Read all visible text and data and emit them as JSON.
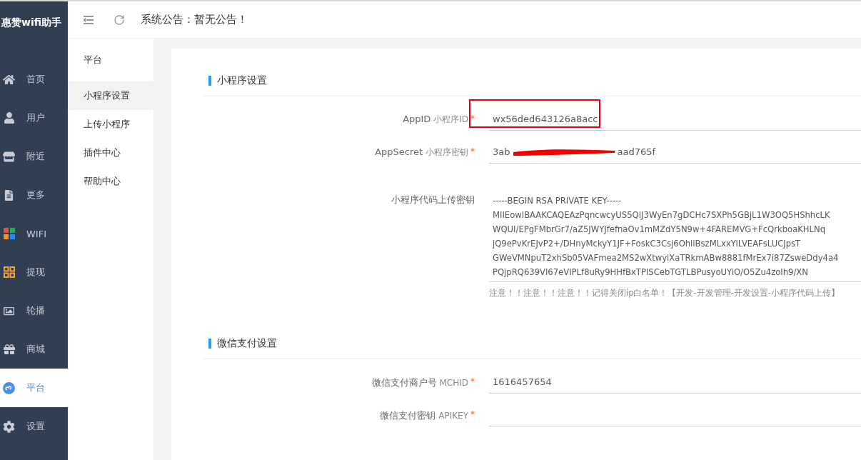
{
  "sidebar": {
    "title": "惠赞wifi助手",
    "items": [
      {
        "label": "首页",
        "selected": false
      },
      {
        "label": "用户",
        "selected": false
      },
      {
        "label": "附近",
        "selected": false
      },
      {
        "label": "更多",
        "selected": false
      },
      {
        "label": "WIFI",
        "selected": false
      },
      {
        "label": "提现",
        "selected": false
      },
      {
        "label": "轮播",
        "selected": false
      },
      {
        "label": "商城",
        "selected": false
      },
      {
        "label": "平台",
        "selected": true
      },
      {
        "label": "设置",
        "selected": false
      }
    ]
  },
  "topbar": {
    "notice": "系统公告：暂无公告！"
  },
  "submenu": {
    "title": "平台",
    "items": [
      {
        "label": "小程序设置",
        "selected": true
      },
      {
        "label": "上传小程序",
        "selected": false
      },
      {
        "label": "插件中心",
        "selected": false
      },
      {
        "label": "帮助中心",
        "selected": false
      }
    ]
  },
  "sections": [
    {
      "title": "小程序设置",
      "fields": [
        {
          "kind": "input",
          "label": "AppID",
          "sublabel": "小程序ID",
          "required_mark": "*",
          "value": "wx56ded643126a8acc",
          "highlighted": true
        },
        {
          "kind": "redacted",
          "label": "AppSecret",
          "sublabel": "小程序密钥",
          "required_mark": "*",
          "value_start": "3ab",
          "value_end": "aad765f"
        },
        {
          "kind": "textarea",
          "label": "小程序代码上传密钥",
          "lines": [
            "-----BEGIN RSA PRIVATE KEY-----",
            "MIIEowIBAAKCAQEAzPqncwcyUS5QIJ3WyEn7gDCHc7SXPh5GBjL1W3OQ5HShhcLK",
            "WQUI/EPgFMbrGr7/aZ5JWYJfefnaOv1mMZdY5N9w+4FAREMVG+FcQrkboaKHLNq",
            "jQ9ePvKrEJvP2+/DHnyMckyY1JF+FoskC3Csj6OhliBszMLxxYiLVEAFsLUCJpsT",
            "GWeVMNpuT2xhSb05VAFmea2MS2wXtwyiXaTRkmABw8881fMrEx7i87ZsweDdy4a4",
            "PQjpRQ639VI67eVIPLf8uRy9HHfBxTPISCebTGTLBPusyoUYiO/O5Zu4zoIh9/XN"
          ],
          "hint": "注意！！注意！！注意！！记得关闭ip白名单！【开发-开发管理-开发设置-小程序代码上传】"
        }
      ]
    },
    {
      "title": "微信支付设置",
      "fields": [
        {
          "kind": "input",
          "label": "微信支付商户号",
          "sublabel": "MCHID",
          "required_mark": "*",
          "value": "1616457654"
        },
        {
          "kind": "input",
          "label": "微信支付密钥",
          "sublabel": "APIKEY",
          "required_mark": "*"
        }
      ]
    }
  ]
}
